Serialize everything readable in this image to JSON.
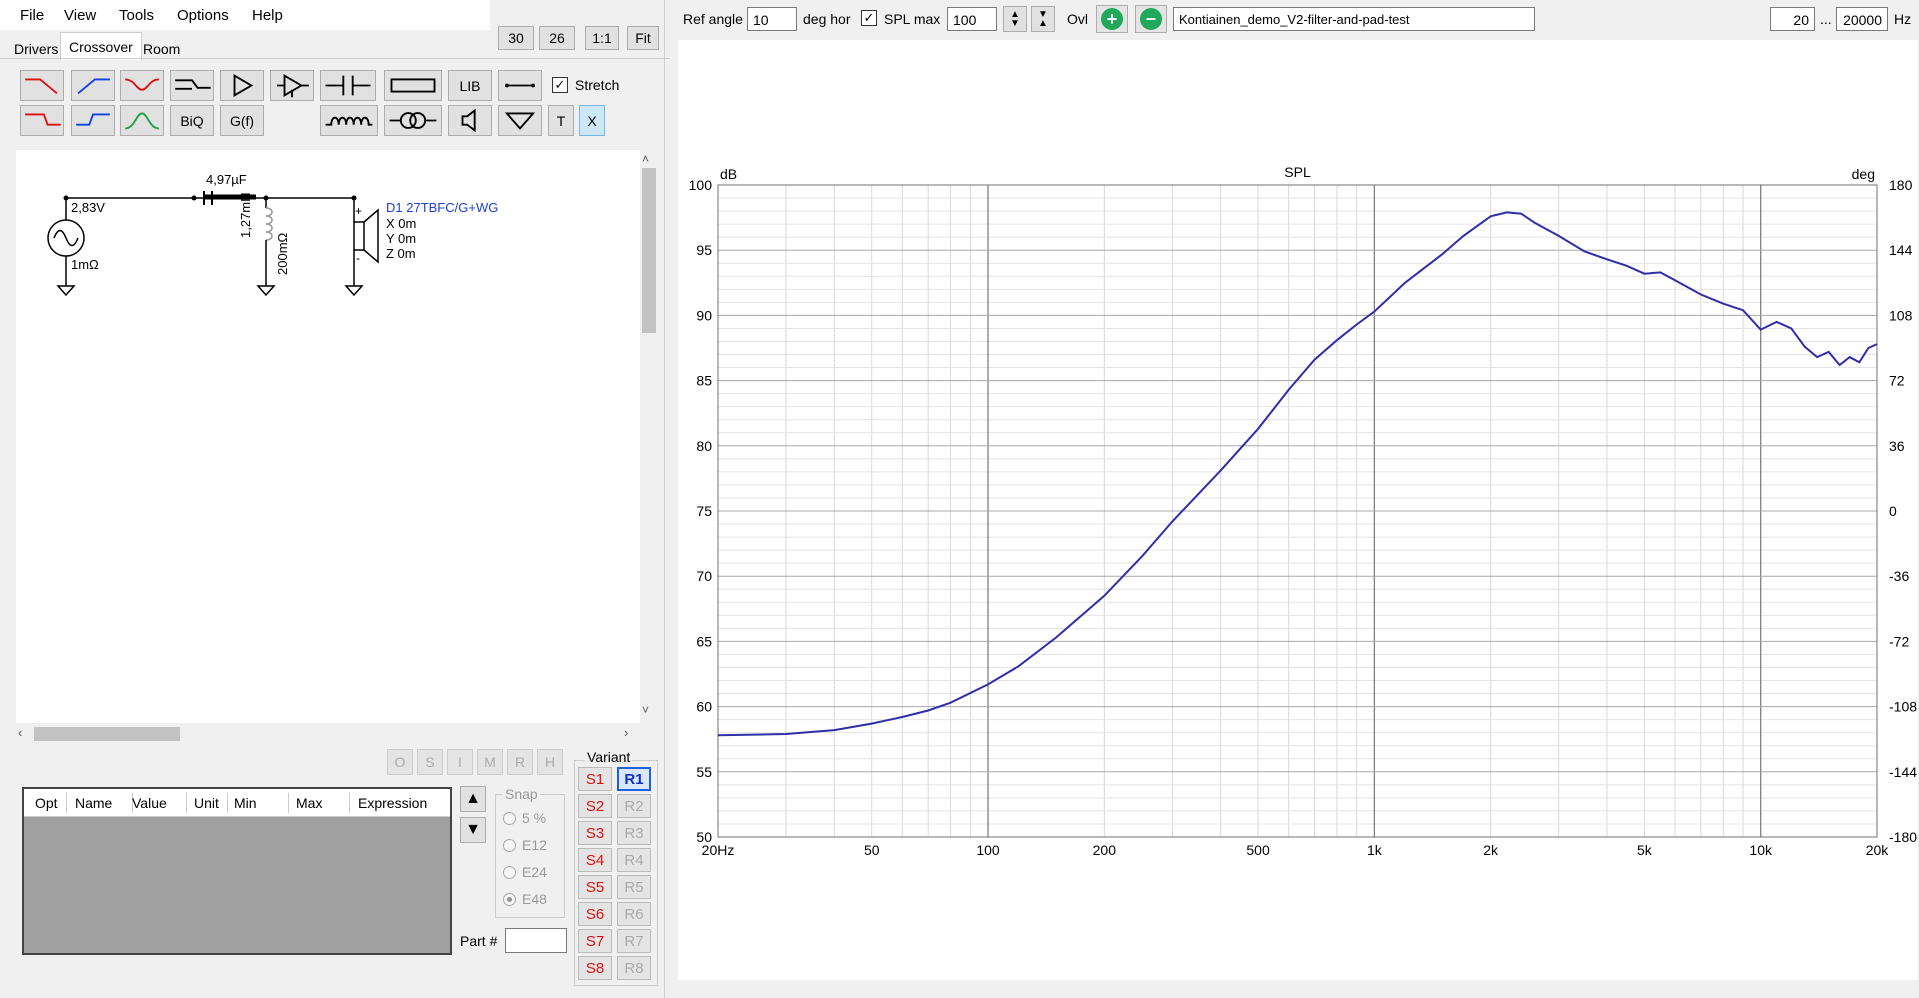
{
  "menu": [
    "File",
    "View",
    "Tools",
    "Options",
    "Help"
  ],
  "tabs": {
    "drivers": "Drivers",
    "crossover": "Crossover",
    "room": "Room"
  },
  "top_buttons": {
    "b30": "30",
    "b26": "26",
    "one_to_one": "1:1",
    "fit": "Fit"
  },
  "toolbar": {
    "lib": "LIB",
    "biq": "BiQ",
    "gf": "G(f)",
    "stretch": "Stretch",
    "t": "T",
    "x": "X"
  },
  "schematic": {
    "source_voltage": "2,83V",
    "source_resistance": "1mΩ",
    "capacitor": "4,97µF",
    "inductor": "1,27mH",
    "inductor_resistance": "200mΩ",
    "driver_name": "D1 27TBFC/G+WG",
    "driver_x": "X 0m",
    "driver_y": "Y 0m",
    "driver_z": "Z 0m",
    "plus": "+",
    "minus": "-"
  },
  "opt_buttons": [
    "O",
    "S",
    "I",
    "M",
    "R",
    "H"
  ],
  "opt_table": {
    "headers": [
      "Opt",
      "Name",
      "Value",
      "Unit",
      "Min",
      "Max",
      "Expression"
    ]
  },
  "snap": {
    "label": "Snap",
    "options": [
      "5 %",
      "E12",
      "E24",
      "E48"
    ],
    "selected": "E48"
  },
  "part": {
    "label": "Part #",
    "value": ""
  },
  "variant": {
    "label": "Variant",
    "s": [
      "S1",
      "S2",
      "S3",
      "S4",
      "S5",
      "S6",
      "S7",
      "S8"
    ],
    "r": [
      "R1",
      "R2",
      "R3",
      "R4",
      "R5",
      "R6",
      "R7",
      "R8"
    ],
    "selected": "R1"
  },
  "header": {
    "ref_angle_label": "Ref angle",
    "ref_angle_value": "10",
    "deg_hor": "deg hor",
    "spl_max_label": "SPL max",
    "spl_max_value": "100",
    "ovl": "Ovl",
    "project_name": "Kontiainen_demo_V2-filter-and-pad-test",
    "freq_min": "20",
    "freq_sep": "...",
    "freq_max": "20000",
    "hz": "Hz"
  },
  "chart_data": {
    "type": "line",
    "title": "SPL",
    "ylabel_left": "dB",
    "ylabel_right": "deg",
    "xscale": "log",
    "xlim": [
      20,
      20000
    ],
    "ylim": [
      50,
      100
    ],
    "ylim_right": [
      -180,
      180
    ],
    "x_ticks": [
      "20Hz",
      "50",
      "100",
      "200",
      "500",
      "1k",
      "2k",
      "5k",
      "10k",
      "20k"
    ],
    "x_tick_values": [
      20,
      50,
      100,
      200,
      500,
      1000,
      2000,
      5000,
      10000,
      20000
    ],
    "y_ticks": [
      50,
      55,
      60,
      65,
      70,
      75,
      80,
      85,
      90,
      95,
      100
    ],
    "y_ticks_right": [
      -180,
      -144,
      -108,
      -72,
      -36,
      0,
      36,
      72,
      108,
      144,
      180
    ],
    "grid": true,
    "series": [
      {
        "color": "#2e2ea8",
        "x": [
          20,
          30,
          40,
          50,
          60,
          70,
          80,
          100,
          120,
          150,
          200,
          250,
          300,
          400,
          500,
          600,
          700,
          800,
          900,
          1000,
          1200,
          1500,
          1700,
          2000,
          2200,
          2400,
          2600,
          3000,
          3500,
          4000,
          4500,
          5000,
          5500,
          6000,
          7000,
          8000,
          9000,
          10000,
          11000,
          12000,
          13000,
          14000,
          15000,
          16000,
          17000,
          18000,
          19000,
          20000
        ],
        "y": [
          57.8,
          57.9,
          58.2,
          58.7,
          59.2,
          59.7,
          60.3,
          61.7,
          63.1,
          65.3,
          68.5,
          71.5,
          74.2,
          78.1,
          81.3,
          84.3,
          86.6,
          88.1,
          89.3,
          90.3,
          92.5,
          94.7,
          96.1,
          97.6,
          97.9,
          97.8,
          97.1,
          96.1,
          94.9,
          94.3,
          93.8,
          93.2,
          93.3,
          92.7,
          91.6,
          90.9,
          90.4,
          88.9,
          89.5,
          89.0,
          87.6,
          86.8,
          87.2,
          86.2,
          86.8,
          86.4,
          87.5,
          87.8
        ]
      }
    ]
  }
}
